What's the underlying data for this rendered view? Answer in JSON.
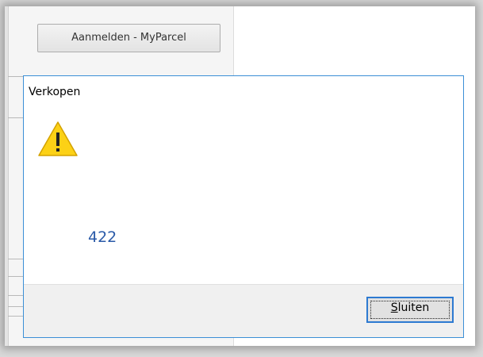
{
  "background_app": {
    "myparcel_button_label": "Aanmelden - MyParcel"
  },
  "dialog": {
    "title": "Verkopen",
    "icon": "warning-icon",
    "message": "422",
    "close_button": {
      "accel_letter": "S",
      "rest": "luiten"
    }
  },
  "colors": {
    "dialog_border": "#3b8fd6",
    "message_text": "#2a5aa8",
    "warning_yellow": "#fcd116"
  }
}
